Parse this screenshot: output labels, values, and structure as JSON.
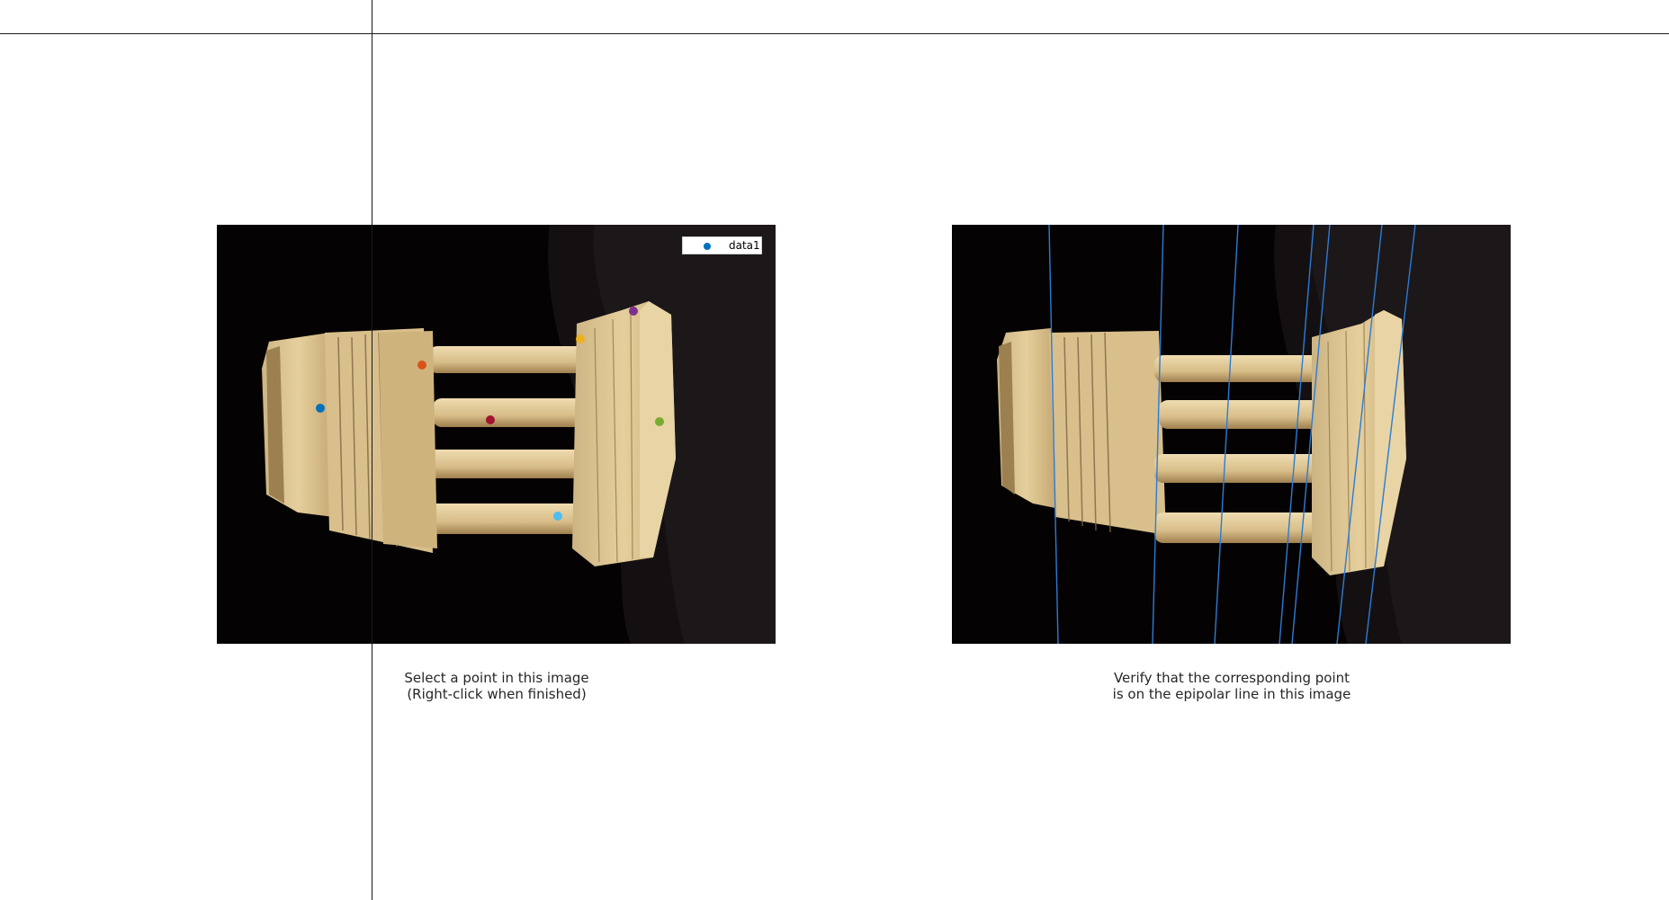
{
  "left_axes": {
    "caption_line1": "Select a point in this image",
    "caption_line2": "(Right-click when finished)",
    "legend_label": "data1",
    "legend_color": "#0072bd"
  },
  "right_axes": {
    "caption_line1": "Verify that the corresponding point",
    "caption_line2": "is on the epipolar line in this image",
    "epipolar_line_color": "#2b7bd6"
  },
  "selected_points": [
    {
      "color": "#0072bd"
    },
    {
      "color": "#d95319"
    },
    {
      "color": "#edb120"
    },
    {
      "color": "#7e2f8e"
    },
    {
      "color": "#77ac30"
    },
    {
      "color": "#4dbeee"
    },
    {
      "color": "#a2142f"
    }
  ]
}
